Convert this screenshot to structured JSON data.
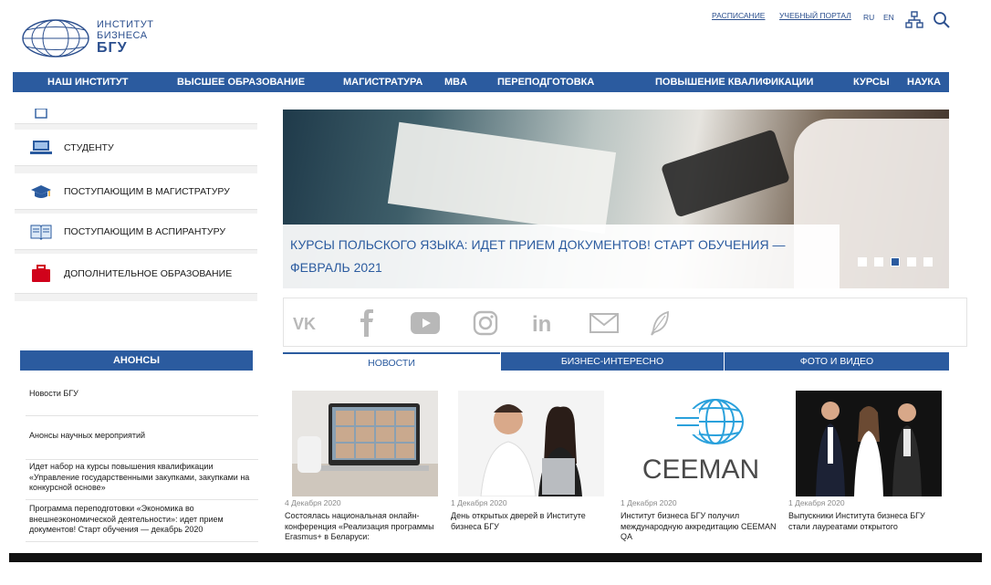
{
  "header": {
    "logo": {
      "line1": "ИНСТИТУТ",
      "line2": "БИЗНЕСА",
      "line3": "БГУ"
    },
    "links": {
      "schedule": "РАСПИСАНИЕ",
      "portal": "УЧЕБНЫЙ ПОРТАЛ",
      "ru": "RU",
      "en": "EN"
    }
  },
  "nav": [
    "НАШ ИНСТИТУТ",
    "ВЫСШЕЕ ОБРАЗОВАНИЕ",
    "МАГИСТРАТУРА",
    "MBA",
    "ПЕРЕПОДГОТОВКА",
    "ПОВЫШЕНИЕ КВАЛИФИКАЦИИ",
    "КУРСЫ",
    "НАУКА"
  ],
  "sidebar": {
    "items": [
      {
        "label": "СТУДЕНТУ",
        "icon": "laptop-icon"
      },
      {
        "label": "ПОСТУПАЮЩИМ В МАГИСТРАТУРУ",
        "icon": "graduation-cap-icon"
      },
      {
        "label": "ПОСТУПАЮЩИМ В АСПИРАНТУРУ",
        "icon": "book-icon"
      },
      {
        "label": "ДОПОЛНИТЕЛЬНОЕ ОБРАЗОВАНИЕ",
        "icon": "briefcase-icon"
      }
    ]
  },
  "anons": {
    "heading": "АНОНСЫ",
    "items": [
      "Новости БГУ",
      "Анонсы научных мероприятий",
      "Идет набор на курсы повышения квалификации «Управление государственными закупками, закупками на конкурсной основе»",
      "Программа переподготовки «Экономика во внешнеэкономической деятельности»: идет прием документов! Старт обучения — декабрь 2020"
    ]
  },
  "slider": {
    "caption": "КУРСЫ ПОЛЬСКОГО ЯЗЫКА: ИДЕТ ПРИЕМ ДОКУМЕНТОВ! СТАРТ ОБУЧЕНИЯ — ФЕВРАЛЬ 2021",
    "dots_count": 5,
    "active_dot": 3
  },
  "social": [
    "vk-icon",
    "facebook-icon",
    "youtube-icon",
    "instagram-icon",
    "linkedin-icon",
    "email-icon",
    "feather-icon"
  ],
  "tabs": [
    "НОВОСТИ",
    "БИЗНЕС-ИНТЕРЕСНО",
    "ФОТО И ВИДЕО"
  ],
  "news": [
    {
      "date": "4 Декабря 2020",
      "title": "Состоялась национальная онлайн-конференция «Реализация программы Erasmus+ в Беларуси:"
    },
    {
      "date": "1 Декабря 2020",
      "title": "День открытых дверей в Институте бизнеса БГУ"
    },
    {
      "date": "1 Декабря 2020",
      "title": "Институт бизнеса БГУ получил международную аккредитацию CEEMAN QA"
    },
    {
      "date": "1 Декабря 2020",
      "title": "Выпускники Института бизнеса БГУ стали лауреатами открытого"
    }
  ],
  "ceeman_logo": "CEEMAN",
  "colors": {
    "brand_blue": "#2b5b9f",
    "logo_blue": "#2b4f8e"
  }
}
